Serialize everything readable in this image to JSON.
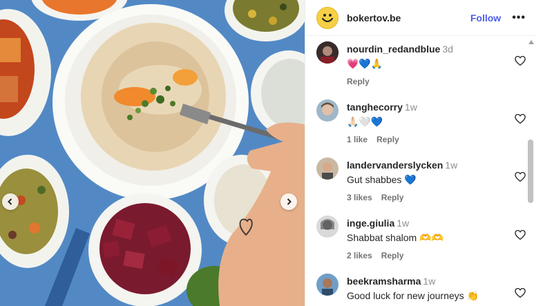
{
  "post": {
    "account": "bokertov.be",
    "follow_label": "Follow",
    "more_label": "•••"
  },
  "comments": [
    {
      "user": "nourdin_redandblue",
      "time": "3d",
      "text": "💗💙🙏",
      "likes": "",
      "reply": "Reply"
    },
    {
      "user": "tanghecorry",
      "time": "1w",
      "text": "🙏🏻🤍💙",
      "likes": "1 like",
      "reply": "Reply"
    },
    {
      "user": "landervanderslycken",
      "time": "1w",
      "text": "Gut shabbes 💙",
      "likes": "3 likes",
      "reply": "Reply"
    },
    {
      "user": "inge.giulia",
      "time": "1w",
      "text": "Shabbat shalom 🫶🫶",
      "likes": "2 likes",
      "reply": "Reply"
    },
    {
      "user": "beekramsharma",
      "time": "1w",
      "text": "Good luck for new journeys 👏",
      "likes": "",
      "reply": ""
    }
  ],
  "colors": {
    "accent": "#4d5fe6",
    "photo_background": "#4f86c4"
  },
  "icons": {
    "carousel_prev": "chevron-left-icon",
    "carousel_next": "chevron-right-icon",
    "like": "heart-outline-icon",
    "scroll_up": "triangle-up-icon"
  }
}
